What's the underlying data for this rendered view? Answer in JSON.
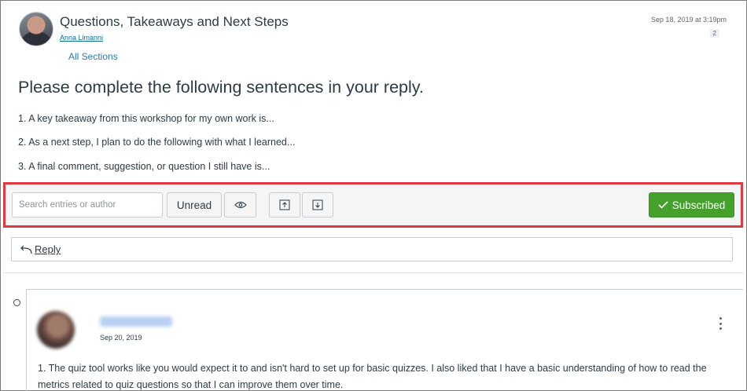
{
  "topic": {
    "title": "Questions, Takeaways and Next Steps",
    "author": "Anna Limanni",
    "sections_link": "All Sections",
    "posted": "Sep 18, 2019 at 3:19pm",
    "reply_count": "2"
  },
  "prompt": {
    "heading": "Please complete the following sentences in your reply.",
    "lines": [
      "1. A key takeaway from this workshop for my own work is...",
      "2. As a next step, I plan to do the following with what I learned...",
      "3. A final comment, suggestion, or question I still have is..."
    ]
  },
  "toolbar": {
    "search_placeholder": "Search entries or author",
    "unread_label": "Unread",
    "subscribed_label": "Subscribed"
  },
  "reply": {
    "label": "Reply"
  },
  "entry": {
    "date": "Sep 20, 2019",
    "text": "1. The quiz tool works like you would expect it to and isn't hard to set up for basic quizzes. I also liked that I have a basic understanding of how to read the metrics related to quiz questions so that I can improve them over time."
  },
  "colors": {
    "highlight_border": "#e0393f",
    "subscribed_green": "#44a22c",
    "link_blue": "#0770a3"
  },
  "icons": [
    "eye-icon",
    "collapse-all-icon",
    "expand-all-icon",
    "checkmark-icon",
    "reply-arrow-icon",
    "kebab-menu-icon"
  ]
}
